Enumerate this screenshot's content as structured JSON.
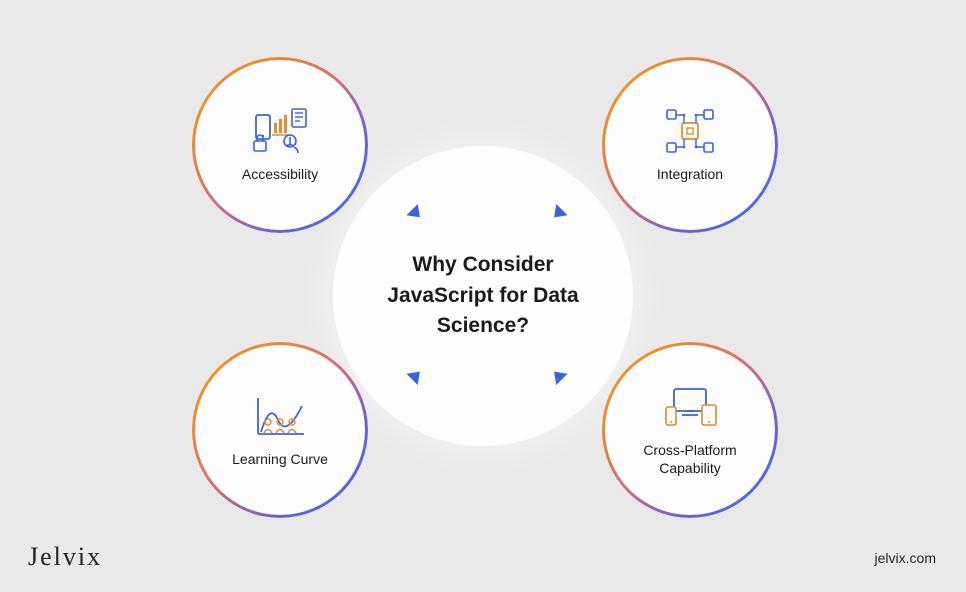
{
  "center": {
    "title": "Why Consider JavaScript for Data Science?"
  },
  "nodes": {
    "topLeft": {
      "label": "Accessibility",
      "icon": "accessibility-icon"
    },
    "topRight": {
      "label": "Integration",
      "icon": "integration-icon"
    },
    "bottomLeft": {
      "label": "Learning Curve",
      "icon": "learning-curve-icon"
    },
    "bottomRight": {
      "label": "Cross-Platform Capability",
      "icon": "cross-platform-icon"
    }
  },
  "brand": {
    "logo": "Jelvix",
    "url": "jelvix.com"
  },
  "colors": {
    "blue": "#3b63da",
    "orange": "#e88a2e"
  }
}
